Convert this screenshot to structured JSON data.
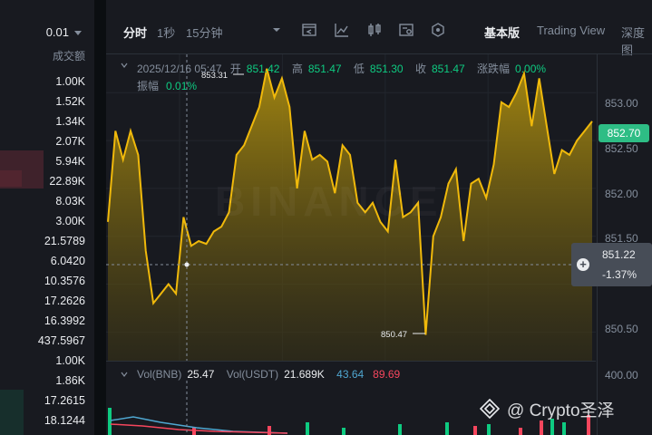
{
  "order_book": {
    "precision": "0.01",
    "header": "成交额",
    "rows": [
      "1.00K",
      "1.52K",
      "1.34K",
      "2.07K",
      "5.94K",
      "22.89K",
      "8.03K",
      "3.00K",
      "21.5789",
      "6.0420",
      "10.3576",
      "17.2626",
      "16.3992",
      "437.5967",
      "1.00K",
      "1.86K",
      "17.2615",
      "18.1244"
    ]
  },
  "toolbar": {
    "tab_time": "分时",
    "tab_1s": "1秒",
    "tab_15m": "15分钟",
    "view_basic": "基本版",
    "view_tv": "Trading View",
    "view_depth": "深度图",
    "icons": [
      "chevron-down-icon",
      "indicator-icon",
      "line-tool-icon",
      "candle-type-icon",
      "settings-icon",
      "hexagon-icon"
    ]
  },
  "ohlc": {
    "datetime": "2025/12/16 05:47",
    "open_label": "开",
    "open": "851.42",
    "high_label": "高",
    "high": "851.47",
    "low_label": "低",
    "low": "851.30",
    "close_label": "收",
    "close": "851.47",
    "change_label": "涨跌幅",
    "change": "0.00%",
    "amp_label": "振幅",
    "amp": "0.01%"
  },
  "price_axis": {
    "ticks": [
      "853.00",
      "852.50",
      "852.00",
      "851.50",
      "850.50"
    ],
    "vol_tick": "400.00",
    "current_price": "852.70",
    "cross_price": "851.22",
    "cross_change": "-1.37%"
  },
  "annotations": {
    "high_mark": "853.31",
    "low_mark": "850.47"
  },
  "volume": {
    "label_bnb": "Vol(BNB)",
    "value_bnb": "25.47",
    "label_usdt": "Vol(USDT)",
    "value_usdt": "21.689K",
    "ma1": "43.64",
    "ma2": "89.69"
  },
  "watermark": "@ Crypto圣泽",
  "colors": {
    "up": "#0ecb81",
    "down": "#f6465d",
    "line": "#f0b90b",
    "accent": "#2ebd85"
  },
  "chart_data": {
    "type": "area",
    "y": [
      851.65,
      852.6,
      852.3,
      852.6,
      852.35,
      851.35,
      850.8,
      850.9,
      851.0,
      850.9,
      851.7,
      851.4,
      851.45,
      851.42,
      851.55,
      851.6,
      851.75,
      852.35,
      852.45,
      852.65,
      852.85,
      853.25,
      852.95,
      853.15,
      852.85,
      852.0,
      852.6,
      852.3,
      852.35,
      852.28,
      851.95,
      852.45,
      852.35,
      851.85,
      851.75,
      851.85,
      851.65,
      851.55,
      852.3,
      851.7,
      851.75,
      851.85,
      850.47,
      851.5,
      851.7,
      852.05,
      852.2,
      851.45,
      852.05,
      852.1,
      851.9,
      852.25,
      852.9,
      852.85,
      853.0,
      853.2,
      852.65,
      853.15,
      852.65,
      852.15,
      852.4,
      852.35,
      852.5,
      852.6,
      852.7
    ],
    "ylim": [
      850.2,
      853.4
    ],
    "ylabel": "",
    "xlabel": ""
  }
}
